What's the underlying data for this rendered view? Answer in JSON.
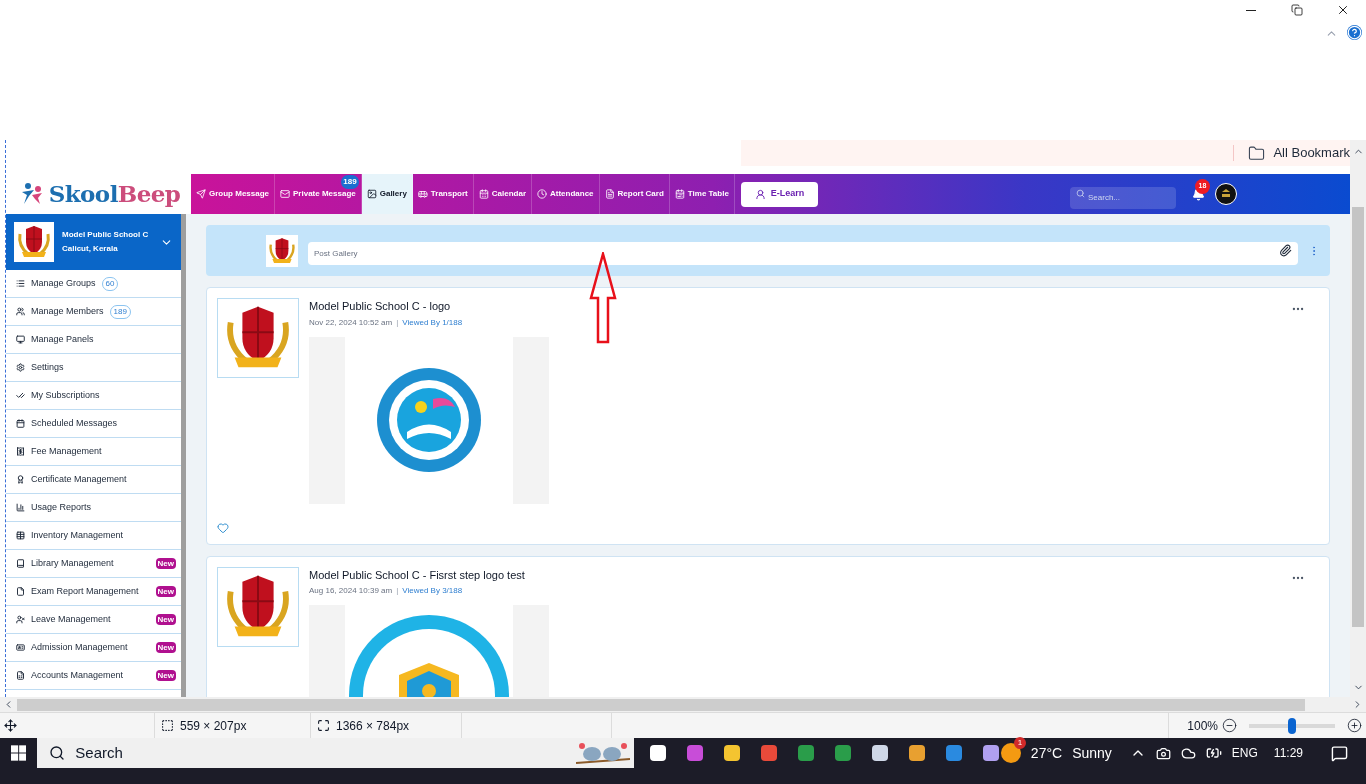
{
  "bookmarks_bar": {
    "label": "All Bookmark"
  },
  "site": {
    "logo": {
      "first": "Skool",
      "second": "Beep"
    },
    "nav": [
      {
        "label": "Group Message",
        "selected": false
      },
      {
        "label": "Private Message",
        "selected": false,
        "badge": "189"
      },
      {
        "label": "Gallery",
        "selected": true
      },
      {
        "label": "Transport",
        "selected": false
      },
      {
        "label": "Calendar",
        "selected": false
      },
      {
        "label": "Attendance",
        "selected": false
      },
      {
        "label": "Report Card",
        "selected": false
      },
      {
        "label": "Time Table",
        "selected": false
      }
    ],
    "elearn": "E-Learn",
    "search": {
      "placeholder": "Search..."
    },
    "notifications": "18"
  },
  "sidebar": {
    "school_name": "Model Public School C",
    "location": "Calicut, Kerala",
    "items": [
      {
        "label": "Manage Groups",
        "count": "60"
      },
      {
        "label": "Manage Members",
        "count": "189"
      },
      {
        "label": "Manage Panels"
      },
      {
        "label": "Settings"
      },
      {
        "label": "My Subscriptions"
      },
      {
        "label": "Scheduled Messages"
      },
      {
        "label": "Fee Management"
      },
      {
        "label": "Certificate Management"
      },
      {
        "label": "Usage Reports"
      },
      {
        "label": "Inventory Management"
      },
      {
        "label": "Library Management",
        "tag": "New"
      },
      {
        "label": "Exam Report Management",
        "tag": "New"
      },
      {
        "label": "Leave Management",
        "tag": "New"
      },
      {
        "label": "Admission Management",
        "tag": "New"
      },
      {
        "label": "Accounts Management",
        "tag": "New"
      }
    ]
  },
  "composer": {
    "placeholder": "Post Gallery"
  },
  "posts": [
    {
      "title": "Model Public School C - logo",
      "date": "Nov 22, 2024 10:52 am",
      "separator": "|",
      "views": "Viewed By 1/188",
      "liked": false
    },
    {
      "title": "Model Public School C - Fisrst step logo test",
      "date": "Aug 16, 2024 10:39 am",
      "separator": "|",
      "views": "Viewed By 3/188"
    }
  ],
  "status_bar": {
    "selection": "559 × 207px",
    "image_size": "1366 × 784px",
    "zoom": "100%",
    "zoom_slider": {
      "level": 0.5
    }
  },
  "taskbar": {
    "search": "Search",
    "weather_badge": "1",
    "temperature": "27°C",
    "weather": "Sunny",
    "language": "ENG",
    "time": "11:29"
  }
}
